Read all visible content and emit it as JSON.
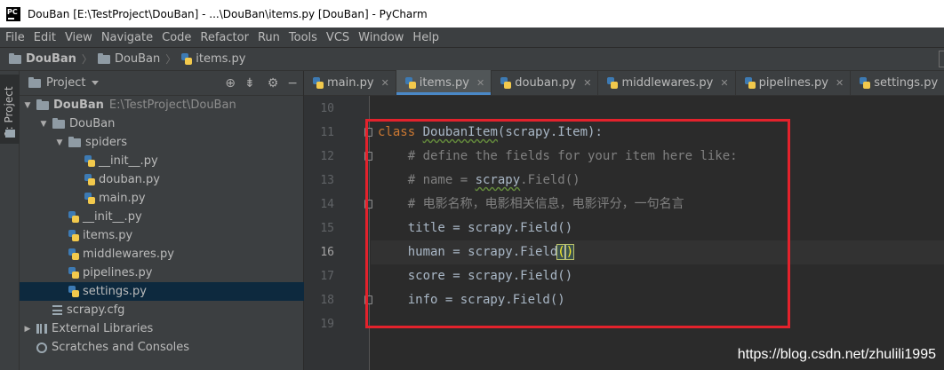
{
  "window": {
    "title": "DouBan [E:\\TestProject\\DouBan] - ...\\DouBan\\items.py [DouBan] - PyCharm",
    "app_icon_label": "PC"
  },
  "menu": [
    "File",
    "Edit",
    "View",
    "Navigate",
    "Code",
    "Refactor",
    "Run",
    "Tools",
    "VCS",
    "Window",
    "Help"
  ],
  "breadcrumb": {
    "root": "DouBan",
    "folder": "DouBan",
    "file": "items.py"
  },
  "sidebar": {
    "project_tab_label": "1: Project"
  },
  "project_panel": {
    "title": "Project",
    "tool_icons": [
      "crosshair-icon",
      "collapse-icon",
      "gear-icon",
      "hide-icon"
    ],
    "tree": [
      {
        "label": "DouBan",
        "path": "E:\\TestProject\\DouBan",
        "depth": 0,
        "expander": "open",
        "icon": "folder",
        "bold": true
      },
      {
        "label": "DouBan",
        "depth": 1,
        "expander": "open",
        "icon": "folder"
      },
      {
        "label": "spiders",
        "depth": 2,
        "expander": "open",
        "icon": "folder"
      },
      {
        "label": "__init__.py",
        "depth": 3,
        "icon": "python"
      },
      {
        "label": "douban.py",
        "depth": 3,
        "icon": "python"
      },
      {
        "label": "main.py",
        "depth": 3,
        "icon": "python"
      },
      {
        "label": "__init__.py",
        "depth": 2,
        "icon": "python"
      },
      {
        "label": "items.py",
        "depth": 2,
        "icon": "python"
      },
      {
        "label": "middlewares.py",
        "depth": 2,
        "icon": "python"
      },
      {
        "label": "pipelines.py",
        "depth": 2,
        "icon": "python"
      },
      {
        "label": "settings.py",
        "depth": 2,
        "icon": "python",
        "selected": true
      },
      {
        "label": "scrapy.cfg",
        "depth": 1,
        "icon": "config"
      },
      {
        "label": "External Libraries",
        "depth": 0,
        "expander": "closed",
        "icon": "library"
      },
      {
        "label": "Scratches and Consoles",
        "depth": 0,
        "icon": "scratch"
      }
    ]
  },
  "tabs": [
    {
      "label": "main.py",
      "active": false
    },
    {
      "label": "items.py",
      "active": true
    },
    {
      "label": "douban.py",
      "active": false
    },
    {
      "label": "middlewares.py",
      "active": false
    },
    {
      "label": "pipelines.py",
      "active": false
    },
    {
      "label": "settings.py",
      "active": false
    }
  ],
  "editor": {
    "current_line": 16,
    "lines": [
      {
        "no": "10",
        "text": ""
      },
      {
        "no": "11",
        "text": "class DoubanItem(scrapy.Item):"
      },
      {
        "no": "12",
        "text": "    # define the fields for your item here like:"
      },
      {
        "no": "13",
        "text": "    # name = scrapy.Field()"
      },
      {
        "no": "14",
        "text": "    # 电影名称，电影相关信息，电影评分，一句名言"
      },
      {
        "no": "15",
        "text": "    title = scrapy.Field()"
      },
      {
        "no": "16",
        "text": "    human = scrapy.Field()"
      },
      {
        "no": "17",
        "text": "    score = scrapy.Field()"
      },
      {
        "no": "18",
        "text": "    info = scrapy.Field()"
      },
      {
        "no": "19",
        "text": ""
      }
    ]
  },
  "watermark": "https://blog.csdn.net/zhulili1995",
  "colors": {
    "keyword": "#cc7832",
    "comment": "#808080",
    "default_code": "#a9b7c6",
    "annotation_box": "#e3222c",
    "selection": "#0d293e",
    "active_tab_accent": "#4a88c7"
  }
}
